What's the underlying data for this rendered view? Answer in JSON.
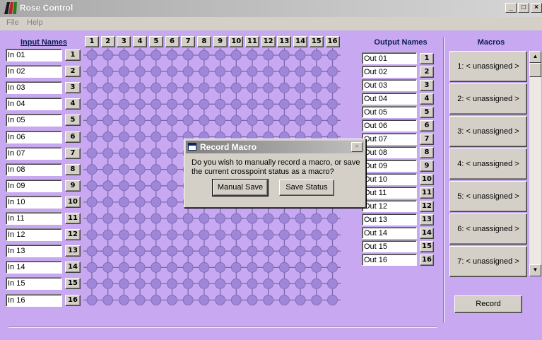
{
  "window": {
    "title": "Rose Control",
    "buttons": [
      "minimize-icon",
      "maximize-icon",
      "close-icon"
    ]
  },
  "menu": {
    "items": [
      "File",
      "Help"
    ]
  },
  "inputs": {
    "header": "Input Names",
    "names": [
      "In 01",
      "In 02",
      "In 03",
      "In 04",
      "In 05",
      "In 06",
      "In 07",
      "In 08",
      "In 09",
      "In 10",
      "In 11",
      "In 12",
      "In 13",
      "In 14",
      "In 15",
      "In 16"
    ],
    "numbers": [
      "1",
      "2",
      "3",
      "4",
      "5",
      "6",
      "7",
      "8",
      "9",
      "10",
      "11",
      "12",
      "13",
      "14",
      "15",
      "16"
    ]
  },
  "columns": {
    "numbers": [
      "1",
      "2",
      "3",
      "4",
      "5",
      "6",
      "7",
      "8",
      "9",
      "10",
      "11",
      "12",
      "13",
      "14",
      "15",
      "16"
    ]
  },
  "outputs": {
    "header": "Output Names",
    "names": [
      "Out 01",
      "Out 02",
      "Out 03",
      "Out 04",
      "Out 05",
      "Out 06",
      "Out 07",
      "Out 08",
      "Out 09",
      "Out 10",
      "Out 11",
      "Out 12",
      "Out 13",
      "Out 14",
      "Out 15",
      "Out 16"
    ],
    "numbers": [
      "1",
      "2",
      "3",
      "4",
      "5",
      "6",
      "7",
      "8",
      "9",
      "10",
      "11",
      "12",
      "13",
      "14",
      "15",
      "16"
    ]
  },
  "macros": {
    "header": "Macros",
    "items": [
      "1: < unassigned >",
      "2: < unassigned >",
      "3: < unassigned >",
      "4: < unassigned >",
      "5: < unassigned >",
      "6: < unassigned >",
      "7: < unassigned >"
    ],
    "record_label": "Record"
  },
  "dialog": {
    "title": "Record Macro",
    "message": "Do you wish to manually record a macro, or save the current crosspoint status as a macro?",
    "manual_save_label": "Manual Save",
    "save_status_label": "Save Status"
  },
  "colors": {
    "background": "#c8a8f0",
    "node": "#9e86d8",
    "line": "#7a68b0",
    "header_text": "#0a1e55"
  }
}
